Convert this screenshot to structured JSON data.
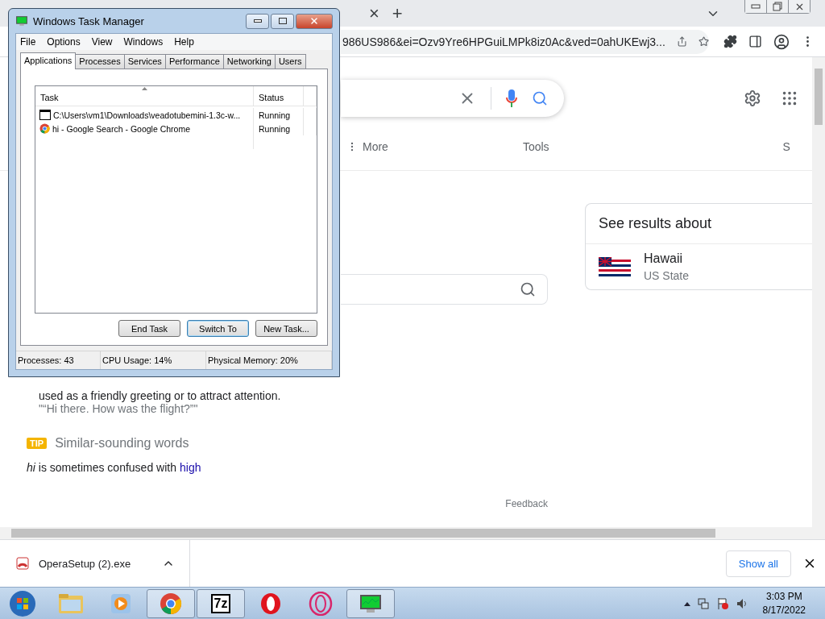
{
  "browser": {
    "tab_strip": {
      "close_tab": "×",
      "new_tab": "+"
    },
    "address_bar": {
      "url": "986US986&ei=Ozv9Yre6HPGuiLMPk8iz0Ac&ved=0ahUKEwj3..."
    }
  },
  "page": {
    "nav": [
      {
        "label": "More",
        "kind": "menu"
      },
      {
        "label": "Tools",
        "kind": "plain"
      },
      {
        "label": "S",
        "kind": "plain"
      }
    ],
    "knowledge_panel": {
      "heading": "See results about",
      "entity": {
        "name": "Hawaii",
        "type": "US State"
      }
    },
    "definition": {
      "text": "used as a friendly greeting or to attract attention.",
      "example": "\"“Hi there. How was the flight?”\""
    },
    "tip": {
      "badge": "TIP",
      "title": "Similar-sounding words",
      "text": "*hi* is sometimes confused with",
      "link": "high"
    },
    "feedback": "Feedback"
  },
  "downloads": {
    "items": [
      {
        "name": "OperaSetup (2).exe"
      }
    ],
    "show_all": "Show all"
  },
  "task_manager": {
    "title": "Windows Task Manager",
    "menu": [
      "File",
      "Options",
      "View",
      "Windows",
      "Help"
    ],
    "tabs": [
      {
        "label": "Applications",
        "selected": true
      },
      {
        "label": "Processes",
        "selected": false
      },
      {
        "label": "Services",
        "selected": false
      },
      {
        "label": "Performance",
        "selected": false
      },
      {
        "label": "Networking",
        "selected": false
      },
      {
        "label": "Users",
        "selected": false
      }
    ],
    "columns": [
      "Task",
      "Status"
    ],
    "rows": [
      {
        "kind": "console",
        "task": "C:\\Users\\vm1\\Downloads\\veadotubemini-1.3c-w...",
        "status": "Running"
      },
      {
        "kind": "browser",
        "task": "hi - Google Search - Google Chrome",
        "status": "Running"
      }
    ],
    "buttons": [
      {
        "label": "End Task",
        "focused": false
      },
      {
        "label": "Switch To",
        "focused": true
      },
      {
        "label": "New Task...",
        "focused": false
      }
    ],
    "status_bar": [
      "Processes: 43",
      "CPU Usage: 14%",
      "Physical Memory: 20%"
    ]
  },
  "taskbar": {
    "apps": [
      {
        "kind": "explorer",
        "running": false
      },
      {
        "kind": "media",
        "running": false
      },
      {
        "kind": "chrome",
        "running": true
      },
      {
        "kind": "archiver",
        "running": true,
        "label": "7z"
      },
      {
        "kind": "opera",
        "running": false
      },
      {
        "kind": "operagx",
        "running": false
      },
      {
        "kind": "taskmgr",
        "running": true
      }
    ],
    "clock": {
      "time": "3:03 PM",
      "date": "8/17/2022"
    }
  }
}
